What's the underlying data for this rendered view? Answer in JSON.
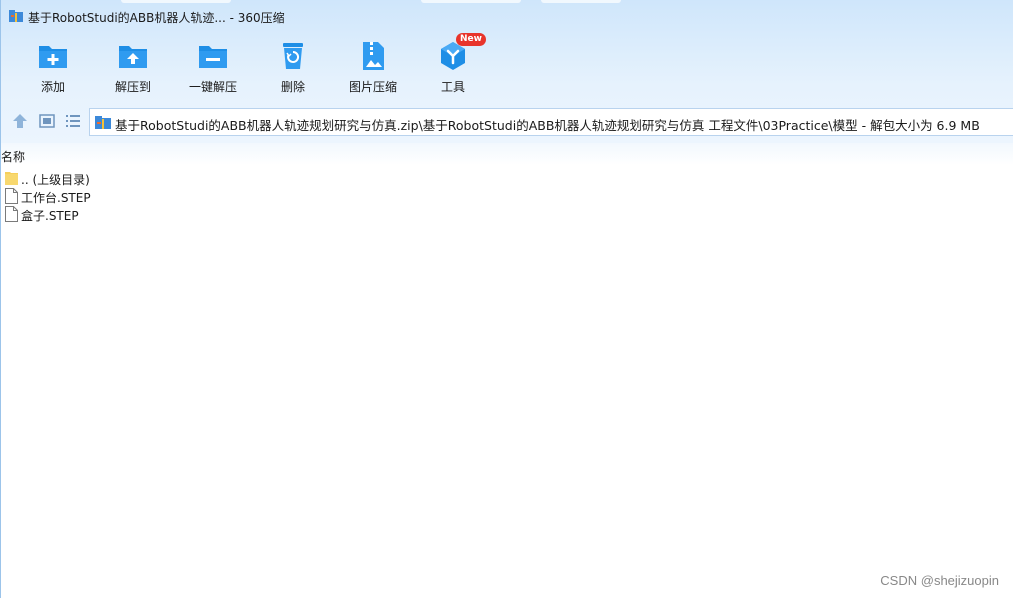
{
  "window": {
    "title": "基于RobotStudi的ABB机器人轨迹... - 360压缩"
  },
  "toolbar": {
    "buttons": [
      {
        "label": "添加",
        "icon": "add-folder-icon"
      },
      {
        "label": "解压到",
        "icon": "extract-to-icon"
      },
      {
        "label": "一键解压",
        "icon": "one-click-extract-icon"
      },
      {
        "label": "删除",
        "icon": "trash-icon"
      },
      {
        "label": "图片压缩",
        "icon": "image-compress-icon"
      },
      {
        "label": "工具",
        "icon": "tools-icon"
      }
    ],
    "new_badge": "New"
  },
  "navigation": {
    "address_path": "基于RobotStudi的ABB机器人轨迹规划研究与仿真.zip\\基于RobotStudi的ABB机器人轨迹规划研究与仿真 工程文件\\03Practice\\模型 - 解包大小为 6.9 MB"
  },
  "list": {
    "column_name": "名称",
    "items": [
      {
        "name": ".. (上级目录)",
        "type": "parent-folder"
      },
      {
        "name": "工作台.STEP",
        "type": "file"
      },
      {
        "name": "盒子.STEP",
        "type": "file"
      }
    ]
  },
  "watermark": "CSDN @shejizuopin",
  "colors": {
    "accent_blue": "#1e8ee6",
    "toolbar_bg": "#dcedfc",
    "badge_red": "#e8342b",
    "folder_yellow": "#f6cf5b"
  }
}
